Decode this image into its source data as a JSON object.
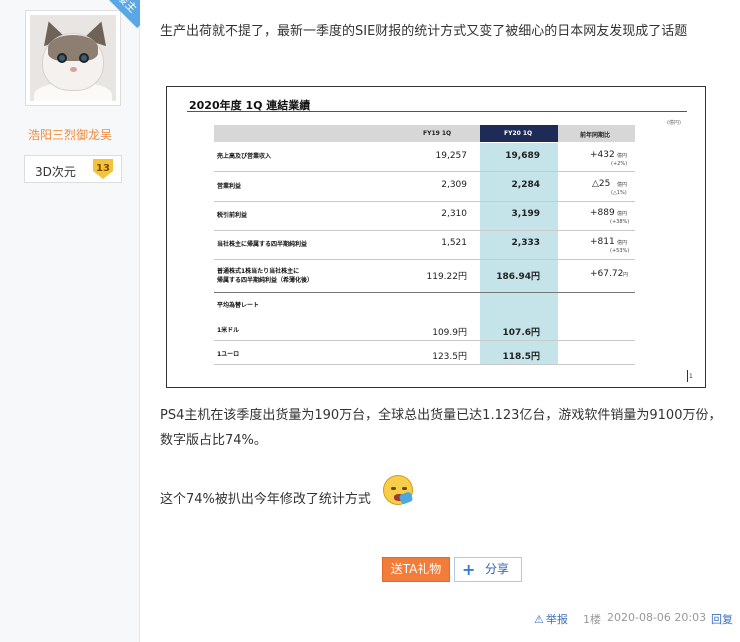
{
  "author": {
    "badge": "楼主",
    "username": "浩阳三烈御龙吴",
    "level_name": "3D次元",
    "level_number": "13"
  },
  "post": {
    "paragraph1": "生产出荷就不提了，最新一季度的SIE财报的统计方式又变了被细心的日本网友发现成了话题",
    "paragraph2": "PS4主机在该季度出货量为190万台，全球总出货量已达1.123亿台，游戏软件销量为9100万份，数字版占比74%。",
    "paragraph3": "这个74%被扒出今年修改了统计方式"
  },
  "financial_table": {
    "title": "2020年度 1Q 連結業績",
    "unit": "(億円)",
    "headers": [
      "FY19 1Q",
      "FY20 1Q",
      "前年同期比"
    ],
    "rows": [
      {
        "label": "売上高及び営業収入",
        "fy19": "19,257",
        "fy20": "19,689",
        "diff": "+432",
        "diff_unit": "億円",
        "pct": "(+2%)"
      },
      {
        "label": "営業利益",
        "fy19": "2,309",
        "fy20": "2,284",
        "diff": "△25",
        "diff_unit": "億円",
        "pct": "(△1%)"
      },
      {
        "label": "税引前利益",
        "fy19": "2,310",
        "fy20": "3,199",
        "diff": "+889",
        "diff_unit": "億円",
        "pct": "(+38%)"
      },
      {
        "label": "当社株主に帰属する四半期純利益",
        "fy19": "1,521",
        "fy20": "2,333",
        "diff": "+811",
        "diff_unit": "億円",
        "pct": "(+53%)"
      },
      {
        "label_line1": "普通株式1株当たり当社株主に",
        "label_line2": "帰属する四半期純利益（希薄化後）",
        "fy19": "119.22円",
        "fy20": "186.94円",
        "diff": "+67.72",
        "diff_unit": "円"
      }
    ],
    "fx_header": "平均為替レート",
    "fx_rows": [
      {
        "label": "1米ドル",
        "fy19": "109.9円",
        "fy20": "107.6円"
      },
      {
        "label": "1ユーロ",
        "fy19": "123.5円",
        "fy20": "118.5円"
      }
    ],
    "page_number": "1"
  },
  "actions": {
    "gift_label": "送TA礼物",
    "share_label": "分享"
  },
  "footer": {
    "report_label": "举报",
    "floor": "1楼",
    "timestamp": "2020-08-06 20:03",
    "reply_label": "回复"
  },
  "colors": {
    "accent_orange": "#f27c3a",
    "link_blue": "#3b6fb8",
    "badge_blue": "#5aa7e5",
    "table_highlight": "#c5e4ea",
    "table_header_navy": "#1e2b57"
  }
}
